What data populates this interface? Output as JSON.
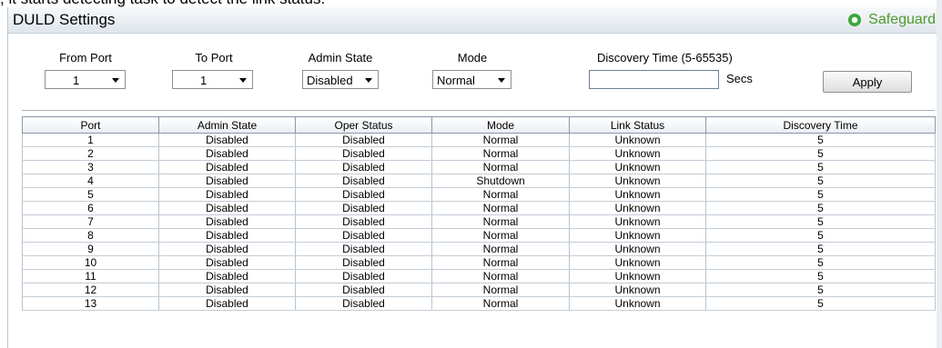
{
  "caption": ", it starts detecting task to detect the link status.",
  "header": {
    "title": "DULD Settings",
    "safeguard_label": "Safeguard",
    "status_color": "#3aa63a"
  },
  "form": {
    "from_port": {
      "label": "From Port",
      "value": "1"
    },
    "to_port": {
      "label": "To Port",
      "value": "1"
    },
    "admin_state": {
      "label": "Admin State",
      "value": "Disabled"
    },
    "mode": {
      "label": "Mode",
      "value": "Normal"
    },
    "discovery_time": {
      "label": "Discovery Time (5-65535)",
      "value": "",
      "unit": "Secs"
    },
    "apply_label": "Apply"
  },
  "table": {
    "columns": [
      "Port",
      "Admin State",
      "Oper Status",
      "Mode",
      "Link Status",
      "Discovery Time"
    ],
    "rows": [
      [
        "1",
        "Disabled",
        "Disabled",
        "Normal",
        "Unknown",
        "5"
      ],
      [
        "2",
        "Disabled",
        "Disabled",
        "Normal",
        "Unknown",
        "5"
      ],
      [
        "3",
        "Disabled",
        "Disabled",
        "Normal",
        "Unknown",
        "5"
      ],
      [
        "4",
        "Disabled",
        "Disabled",
        "Shutdown",
        "Unknown",
        "5"
      ],
      [
        "5",
        "Disabled",
        "Disabled",
        "Normal",
        "Unknown",
        "5"
      ],
      [
        "6",
        "Disabled",
        "Disabled",
        "Normal",
        "Unknown",
        "5"
      ],
      [
        "7",
        "Disabled",
        "Disabled",
        "Normal",
        "Unknown",
        "5"
      ],
      [
        "8",
        "Disabled",
        "Disabled",
        "Normal",
        "Unknown",
        "5"
      ],
      [
        "9",
        "Disabled",
        "Disabled",
        "Normal",
        "Unknown",
        "5"
      ],
      [
        "10",
        "Disabled",
        "Disabled",
        "Normal",
        "Unknown",
        "5"
      ],
      [
        "11",
        "Disabled",
        "Disabled",
        "Normal",
        "Unknown",
        "5"
      ],
      [
        "12",
        "Disabled",
        "Disabled",
        "Normal",
        "Unknown",
        "5"
      ],
      [
        "13",
        "Disabled",
        "Disabled",
        "Normal",
        "Unknown",
        "5"
      ]
    ]
  }
}
